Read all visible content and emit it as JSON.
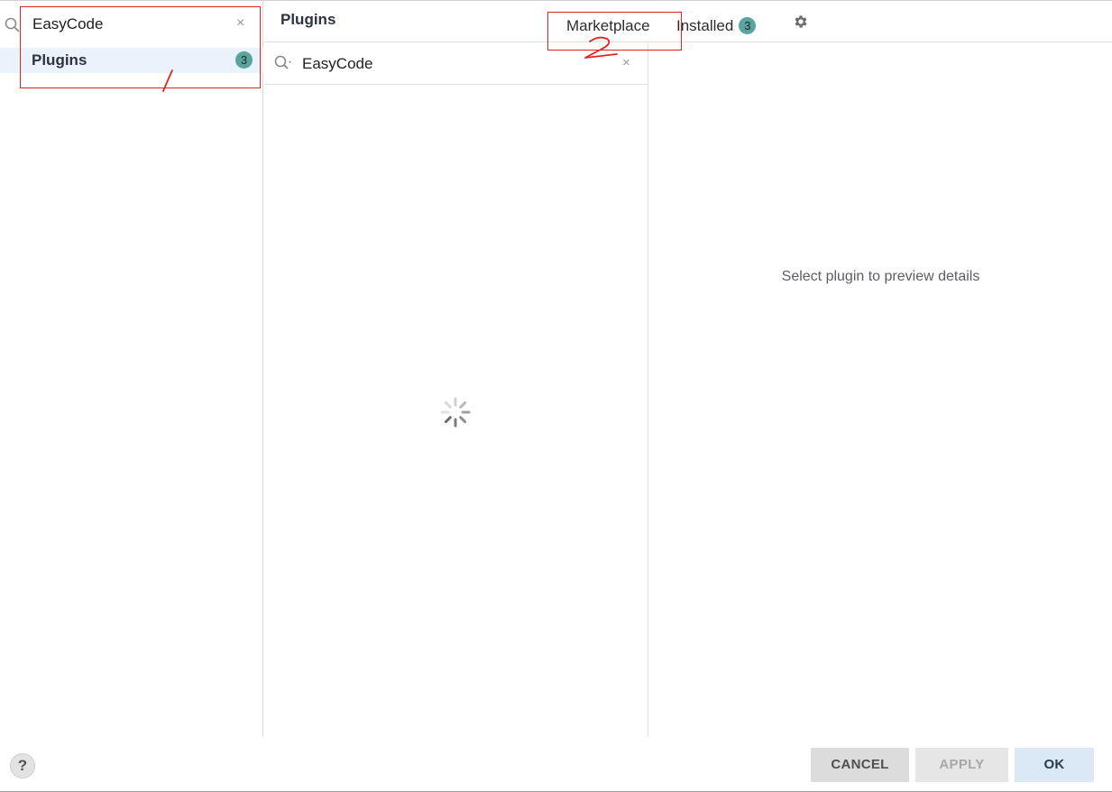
{
  "sidebar": {
    "search": {
      "value": "EasyCode",
      "clear": "×"
    },
    "items": [
      {
        "label": "Plugins",
        "count": "3"
      }
    ]
  },
  "header": {
    "title": "Plugins",
    "tabs": {
      "marketplace": "Marketplace",
      "installed": "Installed",
      "installed_count": "3"
    }
  },
  "plugin_list": {
    "search": {
      "value": "EasyCode",
      "clear": "×"
    },
    "loading": true
  },
  "details": {
    "empty_text": "Select plugin to preview details"
  },
  "footer": {
    "help": "?",
    "cancel": "CANCEL",
    "apply": "APPLY",
    "ok": "OK"
  },
  "icons": [
    "search-icon",
    "search-dropdown-icon",
    "clear-icon",
    "gear-icon",
    "loading-spinner-icon",
    "help-icon"
  ],
  "colors": {
    "badge": "#5aa39f",
    "selection": "#eaf2fb",
    "annotation": "#e0241f",
    "ok_button": "#dbe9f7"
  }
}
